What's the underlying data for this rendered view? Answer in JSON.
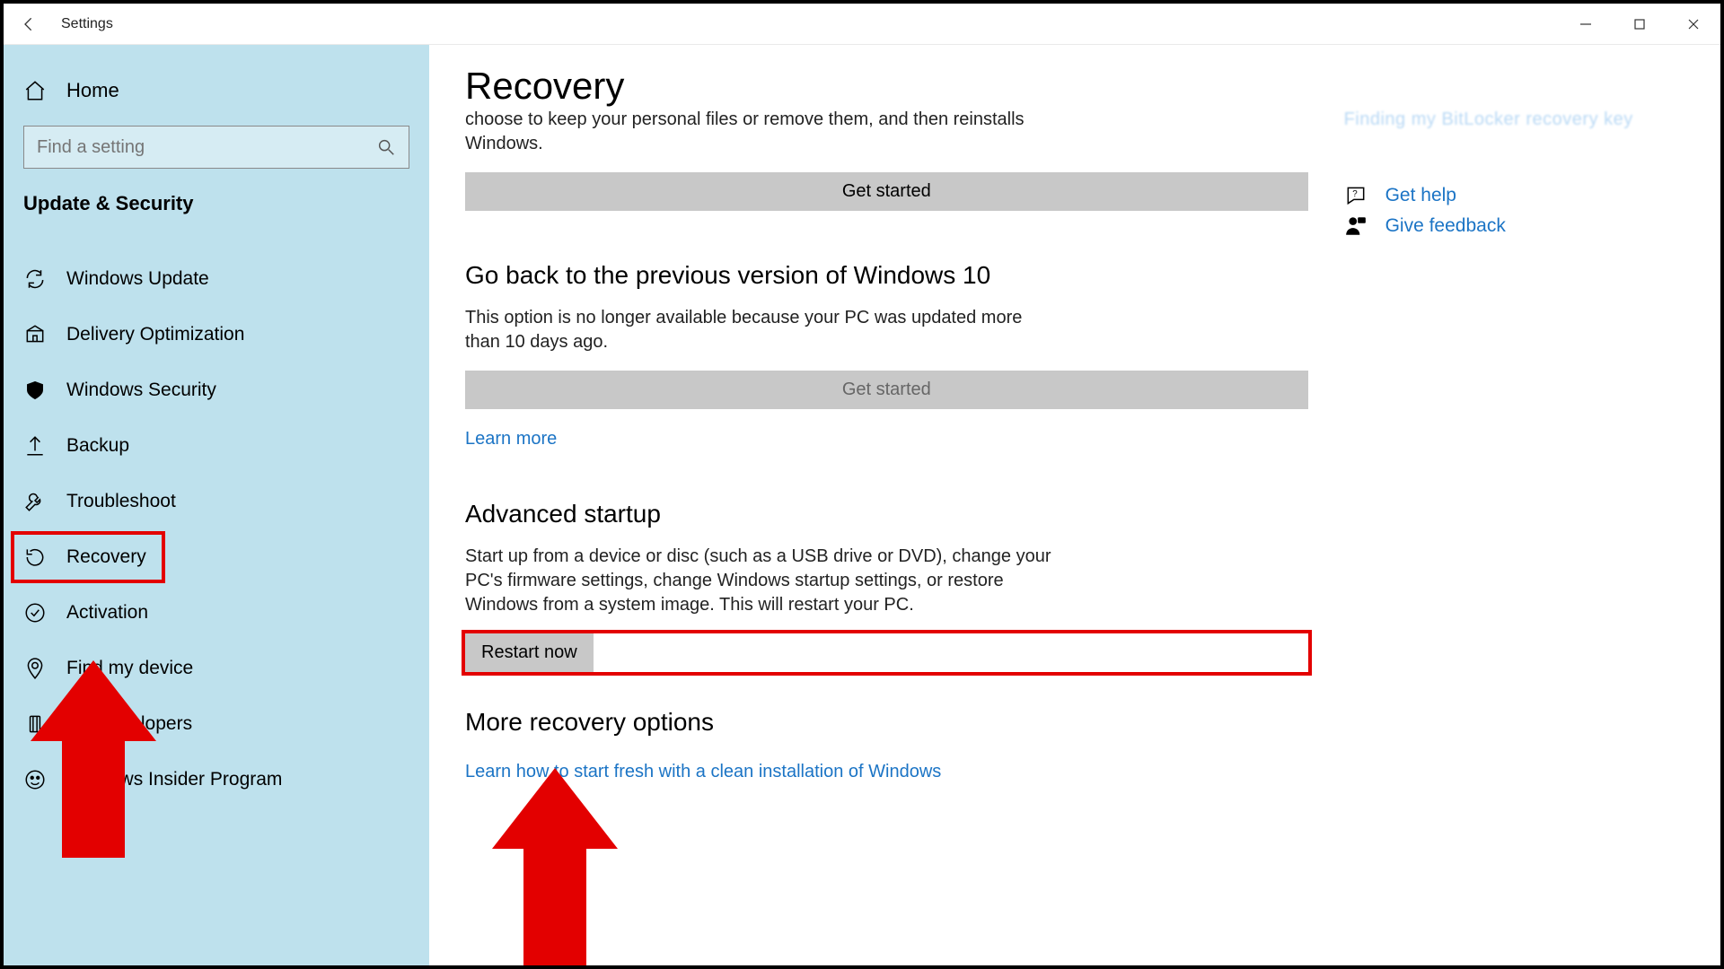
{
  "title": "Settings",
  "sidebar": {
    "home": "Home",
    "search_placeholder": "Find a setting",
    "section": "Update & Security",
    "items": [
      {
        "label": "Windows Update"
      },
      {
        "label": "Delivery Optimization"
      },
      {
        "label": "Windows Security"
      },
      {
        "label": "Backup"
      },
      {
        "label": "Troubleshoot"
      },
      {
        "label": "Recovery"
      },
      {
        "label": "Activation"
      },
      {
        "label": "Find my device"
      },
      {
        "label": "For developers"
      },
      {
        "label": "Windows Insider Program"
      }
    ]
  },
  "main": {
    "page_title": "Recovery",
    "reset": {
      "para": "choose to keep your personal files or remove them, and then reinstalls Windows.",
      "button": "Get started"
    },
    "goback": {
      "heading": "Go back to the previous version of Windows 10",
      "para": "This option is no longer available because your PC was updated more than 10 days ago.",
      "button": "Get started",
      "learn_more": "Learn more"
    },
    "advanced": {
      "heading": "Advanced startup",
      "para": "Start up from a device or disc (such as a USB drive or DVD), change your PC's firmware settings, change Windows startup settings, or restore Windows from a system image. This will restart your PC.",
      "button": "Restart now"
    },
    "more": {
      "heading": "More recovery options",
      "link": "Learn how to start fresh with a clean installation of Windows"
    }
  },
  "right": {
    "blurred": "Finding my BitLocker recovery key",
    "help": "Get help",
    "feedback": "Give feedback"
  }
}
